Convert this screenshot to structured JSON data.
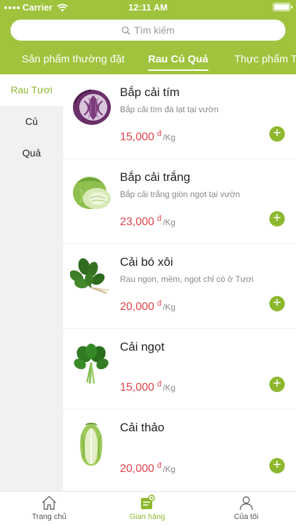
{
  "status_bar": {
    "carrier": "Carrier",
    "time": "12:11 AM"
  },
  "search": {
    "placeholder": "Tìm kiếm",
    "icon": "search-icon"
  },
  "category_tabs": [
    {
      "label": "Sản phẩm thường đặt",
      "active": false
    },
    {
      "label": "Rau Củ Quả",
      "active": true
    },
    {
      "label": "Thực phẩm Tươi",
      "active": false
    }
  ],
  "side_menu": [
    {
      "label": "Rau Tươi",
      "active": true
    },
    {
      "label": "Củ",
      "active": false
    },
    {
      "label": "Quả",
      "active": false
    }
  ],
  "products": [
    {
      "name": "Bắp cải tím",
      "description": "Bắp cải tím đà lạt tại vườn",
      "price": "15,000",
      "currency": "đ",
      "unit": "/Kg",
      "image": "purple-cabbage"
    },
    {
      "name": "Bắp cải trắng",
      "description": "Bắp cải trắng giòn ngọt tại vườn",
      "price": "23,000",
      "currency": "đ",
      "unit": "/Kg",
      "image": "white-cabbage"
    },
    {
      "name": "Cải bó xôi",
      "description": "Rau ngon, mềm, ngọt chỉ có ở Tươi",
      "price": "20,000",
      "currency": "đ",
      "unit": "/Kg",
      "image": "spinach"
    },
    {
      "name": "Cải ngọt",
      "description": "",
      "price": "15,000",
      "currency": "đ",
      "unit": "/Kg",
      "image": "choy-sum"
    },
    {
      "name": "Cải thảo",
      "description": "",
      "price": "20,000",
      "currency": "đ",
      "unit": "/Kg",
      "image": "napa-cabbage"
    }
  ],
  "add_button_symbol": "+",
  "bottom_nav": [
    {
      "label": "Trang chủ",
      "icon": "home-icon",
      "active": false
    },
    {
      "label": "Gian hàng",
      "icon": "store-icon",
      "active": true
    },
    {
      "label": "Của tôi",
      "icon": "user-icon",
      "active": false
    }
  ],
  "colors": {
    "brand": "#9fc33c",
    "accent": "#8db82e",
    "price": "#e2434b"
  }
}
